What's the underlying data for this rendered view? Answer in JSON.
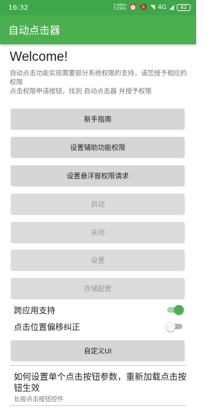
{
  "status_bar": {
    "time": "16:32",
    "net_speed_up": "1.44K/s",
    "net_speed_down": "3.53K/s",
    "network": "4G",
    "battery": "62"
  },
  "app_bar": {
    "title": "自动点击器"
  },
  "main": {
    "welcome": "Welcome!",
    "description_line1": "自动点击功能实现需要部分系统权限的支持，请您授予相应的权限",
    "description_line2": "点击权限申请按钮，找到 自动点击器 并授予权限",
    "buttons": {
      "guide": "新手指南",
      "accessibility": "设置辅助功能权限",
      "overlay": "设置悬浮窗权限请求",
      "start": "启动",
      "close": "关闭",
      "settings": "设置",
      "save_config": "存储配置",
      "custom_ui": "自定义UI"
    },
    "switches": {
      "cross_app": {
        "label": "跨应用支持",
        "on": true
      },
      "offset_fix": {
        "label": "点击位置偏移纠正",
        "on": false
      }
    },
    "tip": {
      "title": "如何设置单个点击按钮参数，重新加载点击按钮生效",
      "subtitle": "长按点击按钮控件"
    }
  },
  "colors": {
    "accent": "#4caf50",
    "status_bar": "#3fa64a",
    "button": "#d6d6d6"
  }
}
